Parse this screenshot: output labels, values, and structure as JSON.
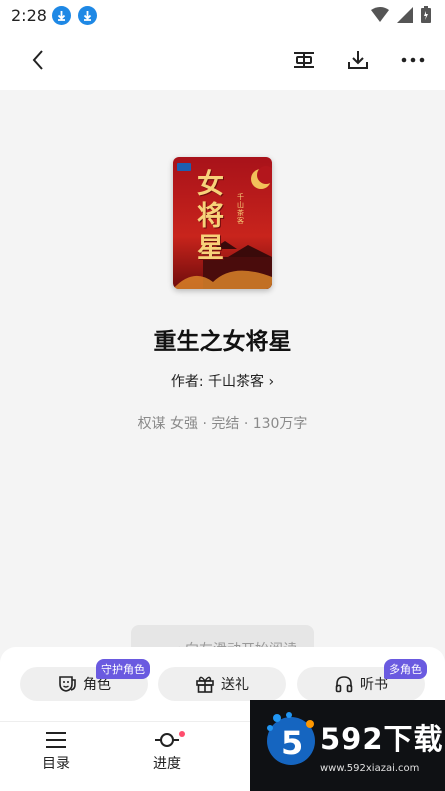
{
  "status": {
    "time": "2:28"
  },
  "book": {
    "title": "重生之女将星",
    "author_line": "作者: 千山茶客 ›",
    "tags": "权谋  女强 · 完结 · 130万字",
    "cover_title_art": "女将星",
    "cover_side_text": "千山茶客"
  },
  "swipe_hint": "‹  向左滑动开始阅读",
  "actions": [
    {
      "label": "角色",
      "badge": "守护角色",
      "icon": "mask-icon"
    },
    {
      "label": "送礼",
      "icon": "gift-icon"
    },
    {
      "label": "听书",
      "badge": "多角色",
      "icon": "headphones-icon"
    }
  ],
  "tabs": [
    {
      "label": "目录",
      "icon": "menu-icon"
    },
    {
      "label": "进度",
      "icon": "progress-icon"
    }
  ],
  "watermark": {
    "brand": "592下载",
    "url": "www.592xiazai.com",
    "logo_char": "5"
  },
  "colors": {
    "accent": "#6a5ae0",
    "download_icon": "#1e88e5",
    "dot": "#ff4d6d"
  }
}
